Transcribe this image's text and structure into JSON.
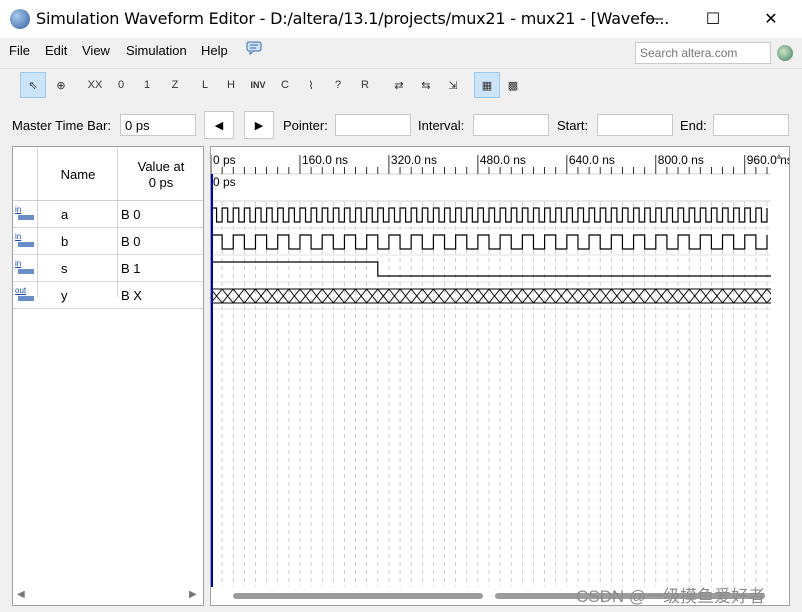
{
  "window": {
    "title": "Simulation Waveform Editor - D:/altera/13.1/projects/mux21 - mux21 - [Wavefo...",
    "minimize_glyph": "—",
    "maximize_glyph": "☐",
    "close_glyph": "✕"
  },
  "menu": {
    "items": [
      {
        "label": "File"
      },
      {
        "label": "Edit"
      },
      {
        "label": "View"
      },
      {
        "label": "Simulation"
      },
      {
        "label": "Help"
      }
    ],
    "help_icon": "speech-bubble-icon",
    "search_placeholder": "Search altera.com",
    "globe_icon": "globe-icon"
  },
  "toolbar": {
    "buttons": [
      {
        "name": "selection-tool",
        "glyph": "⇖",
        "active": true
      },
      {
        "name": "zoom-tool",
        "glyph": "⊕",
        "active": false
      },
      {
        "name": "unknown-value",
        "glyph": "XX",
        "active": false
      },
      {
        "name": "forcing-low",
        "glyph": "0",
        "active": false
      },
      {
        "name": "forcing-high",
        "glyph": "1",
        "active": false
      },
      {
        "name": "high-impedance",
        "glyph": "Z",
        "active": false
      },
      {
        "name": "weak-low",
        "glyph": "L",
        "active": false
      },
      {
        "name": "weak-high",
        "glyph": "H",
        "active": false
      },
      {
        "name": "invert",
        "glyph": "INV",
        "active": false
      },
      {
        "name": "count-value",
        "glyph": "C",
        "active": false
      },
      {
        "name": "clock",
        "glyph": "⌇",
        "active": false
      },
      {
        "name": "arbitrary-value",
        "glyph": "?",
        "active": false
      },
      {
        "name": "random-values",
        "glyph": "R",
        "active": false
      },
      {
        "name": "run-functional-simulation",
        "glyph": "⇄",
        "active": false
      },
      {
        "name": "run-timing-simulation",
        "glyph": "⇆",
        "active": false
      },
      {
        "name": "generate-netlist",
        "glyph": "⇲",
        "active": false
      },
      {
        "name": "snap-to-grid",
        "glyph": "▦",
        "active": true
      },
      {
        "name": "grid-options",
        "glyph": "▩",
        "active": false
      }
    ]
  },
  "timebar": {
    "master_label": "Master Time Bar:",
    "master_value": "0 ps",
    "prev_glyph": "◀",
    "next_glyph": "▶",
    "pointer_label": "Pointer:",
    "pointer_value": "",
    "interval_label": "Interval:",
    "interval_value": "",
    "start_label": "Start:",
    "start_value": "",
    "end_label": "End:",
    "end_value": ""
  },
  "signals": {
    "header_name": "Name",
    "header_value_line1": "Value at",
    "header_value_line2": "0 ps",
    "rows": [
      {
        "dir": "in",
        "name": "a",
        "value": "B 0"
      },
      {
        "dir": "in",
        "name": "b",
        "value": "B 0"
      },
      {
        "dir": "in",
        "name": "s",
        "value": "B 1"
      },
      {
        "dir": "out",
        "name": "y",
        "value": "B X"
      }
    ],
    "scroll_left_glyph": "◀",
    "scroll_right_glyph": "▶"
  },
  "waveform": {
    "time_labels": [
      "0 ps",
      "160.0 ns",
      "320.0 ns",
      "480.0 ns",
      "640.0 ns",
      "800.0 ns",
      "960.0 ns"
    ],
    "cursor_label": "0 ps",
    "scroll_up_glyph": "▲",
    "signal_a_period_ns": 20,
    "signal_b_period_ns": 40,
    "signal_s_high_until_ns": 300,
    "signal_y_state": "unknown"
  },
  "watermark": "CSDN @一级摸鱼爱好者",
  "colors": {
    "master_time_line": "#0000c0",
    "wave": "#000000",
    "grid_dash": "#b8b8b8",
    "active_tool_bg": "#cce4f7"
  }
}
